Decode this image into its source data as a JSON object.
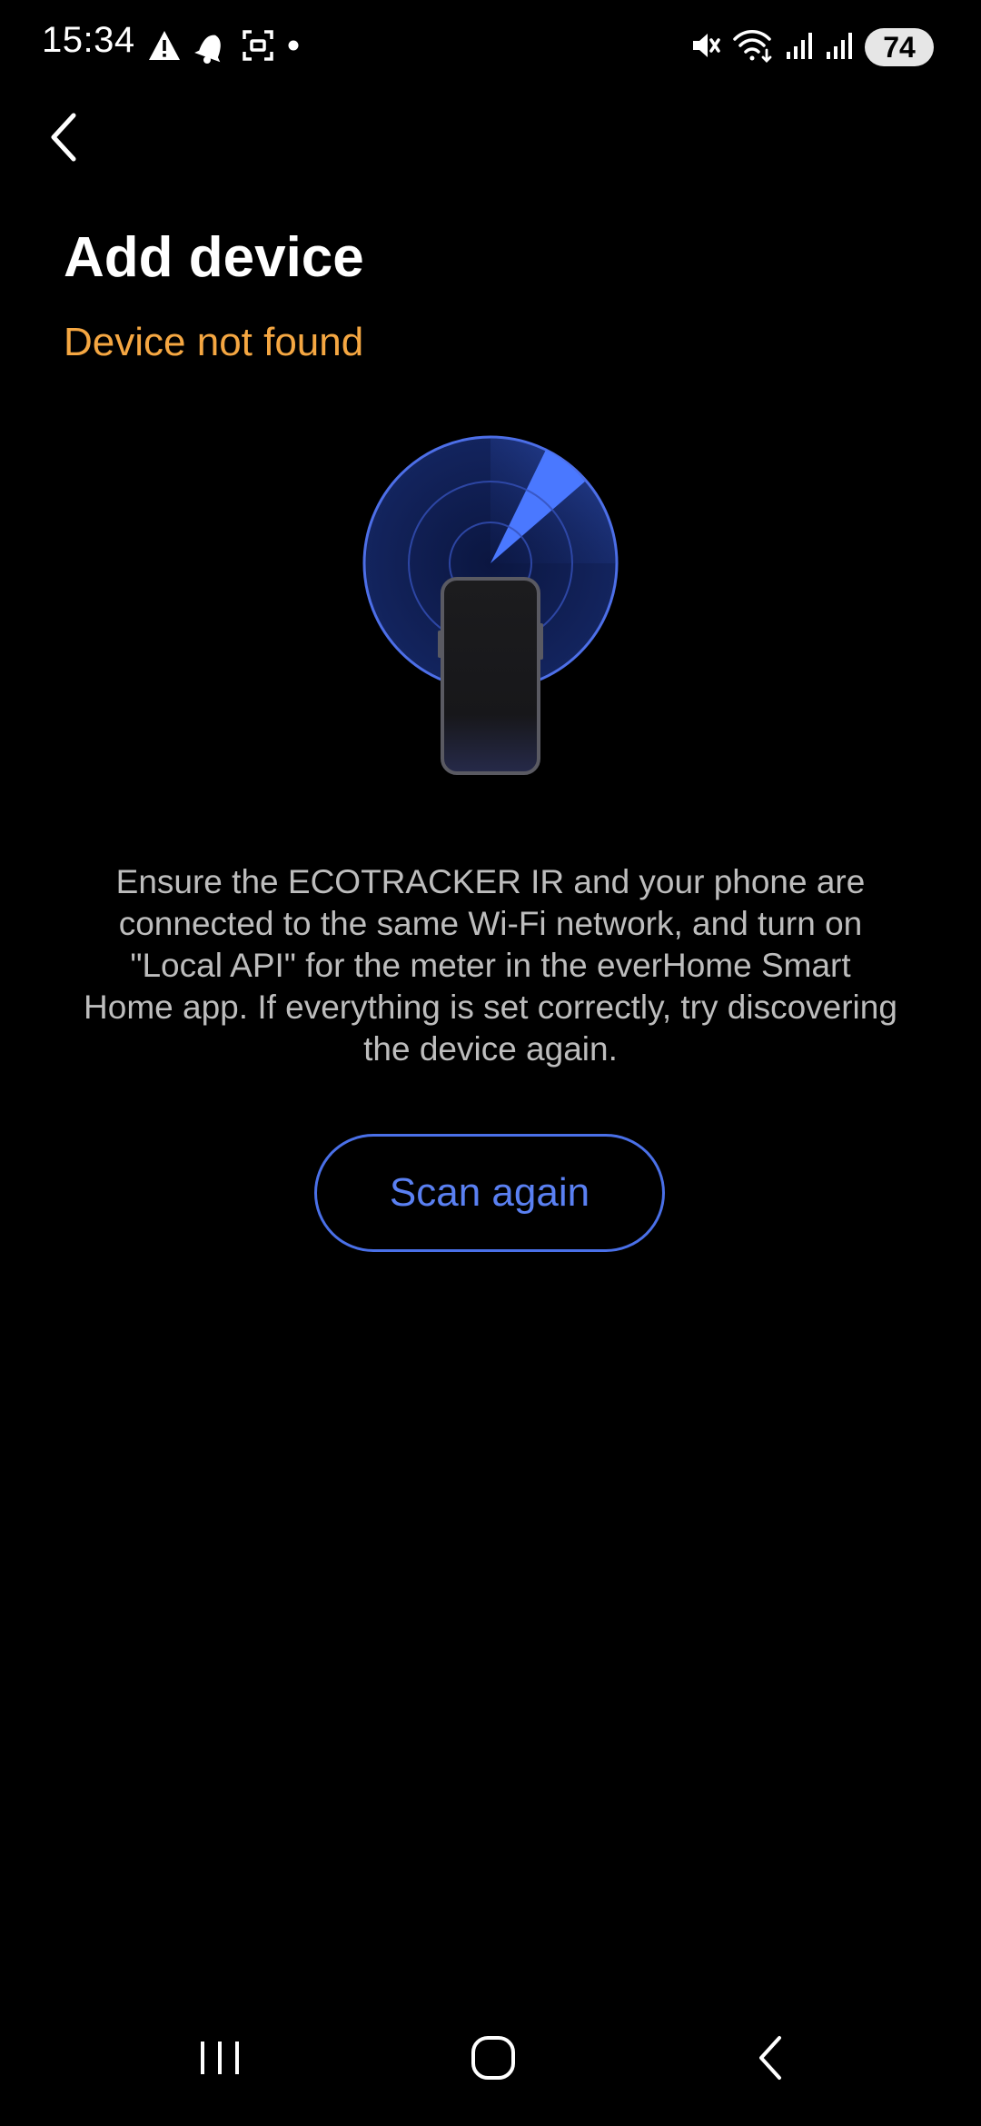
{
  "status_bar": {
    "time": "15:34",
    "battery_level": "74",
    "left_icons": [
      "warning-icon",
      "notification-bell-icon",
      "screenshot-icon",
      "dot-icon"
    ],
    "right_icons": [
      "mute-icon",
      "wifi-icon",
      "signal-icon",
      "signal-icon",
      "battery-icon"
    ]
  },
  "header": {
    "back_icon": "back-chevron-icon",
    "title": "Add device",
    "subtitle": "Device not found"
  },
  "illustration": {
    "name": "radar-phone-illustration"
  },
  "main": {
    "instructions": "Ensure the ECOTRACKER IR and your phone are connected to the same Wi-Fi network, and turn on \"Local API\" for the meter in the everHome Smart Home app. If everything is set correctly, try discovering the device again.",
    "scan_again_label": "Scan again"
  },
  "nav_bar": {
    "items": [
      "recent-apps-icon",
      "home-icon",
      "back-icon"
    ]
  },
  "colors": {
    "background": "#000000",
    "title": "#ffffff",
    "subtitle_warning": "#f5a742",
    "body_text": "#bdbdbd",
    "accent": "#4a70e8"
  }
}
